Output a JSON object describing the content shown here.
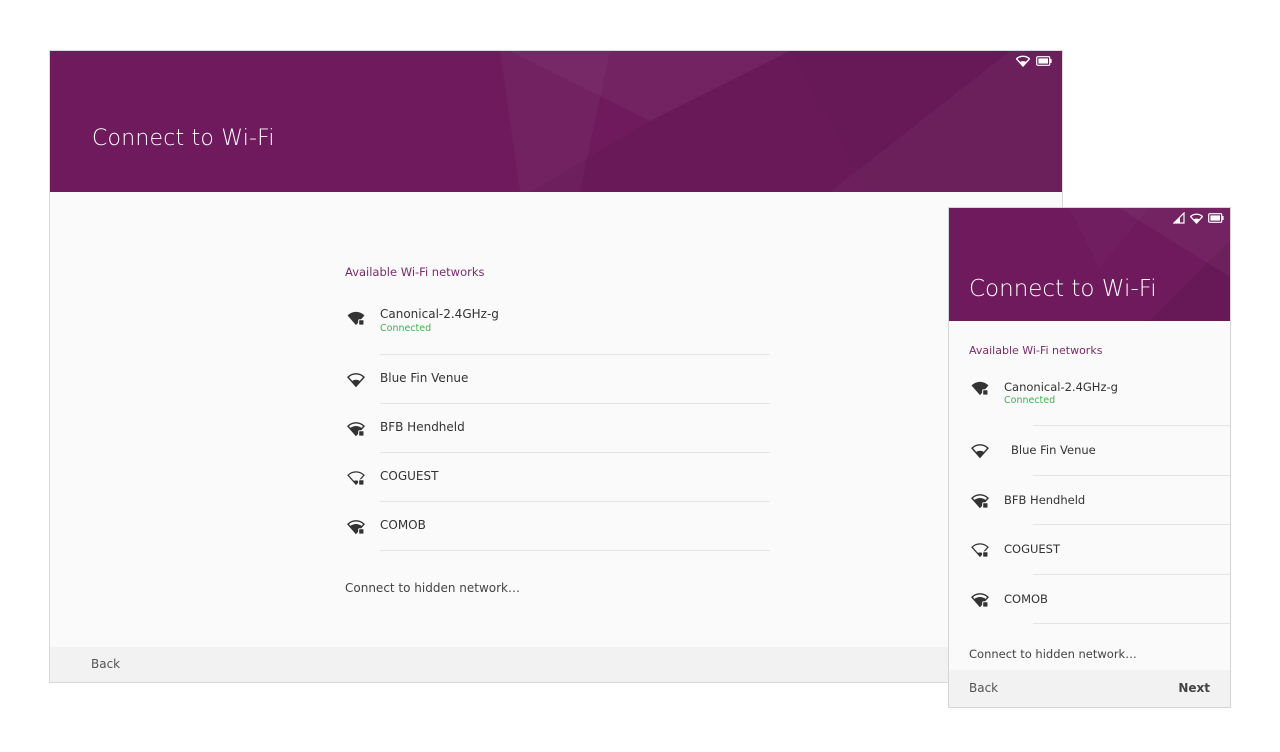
{
  "tablet": {
    "title": "Connect to Wi-Fi",
    "section_label": "Available Wi-Fi networks",
    "networks": [
      {
        "name": "Canonical-2.4GHz-g",
        "status": "Connected",
        "icon": "wifi-secure-full-icon"
      },
      {
        "name": "Blue Fin Venue",
        "status": "",
        "icon": "wifi-open-icon"
      },
      {
        "name": "BFB Hendheld",
        "status": "",
        "icon": "wifi-secure-icon"
      },
      {
        "name": "COGUEST",
        "status": "",
        "icon": "wifi-secure-outline-icon"
      },
      {
        "name": "COMOB",
        "status": "",
        "icon": "wifi-secure-icon"
      }
    ],
    "hidden_network": "Connect to hidden  network…",
    "back_label": "Back"
  },
  "phone": {
    "title": "Connect to Wi-Fi",
    "section_label": "Available Wi-Fi networks",
    "networks": [
      {
        "name": "Canonical-2.4GHz-g",
        "status": "Connected",
        "icon": "wifi-secure-full-icon"
      },
      {
        "name": "Blue Fin Venue",
        "status": "",
        "icon": "wifi-open-icon"
      },
      {
        "name": "BFB Hendheld",
        "status": "",
        "icon": "wifi-secure-icon"
      },
      {
        "name": "COGUEST",
        "status": "",
        "icon": "wifi-secure-outline-icon"
      },
      {
        "name": "COMOB",
        "status": "",
        "icon": "wifi-secure-icon"
      }
    ],
    "hidden_network": "Connect to hidden  network…",
    "back_label": "Back",
    "next_label": "Next"
  },
  "colors": {
    "header": "#6e1a5c",
    "accent": "#7b2b6e",
    "connected": "#3eb34f"
  }
}
